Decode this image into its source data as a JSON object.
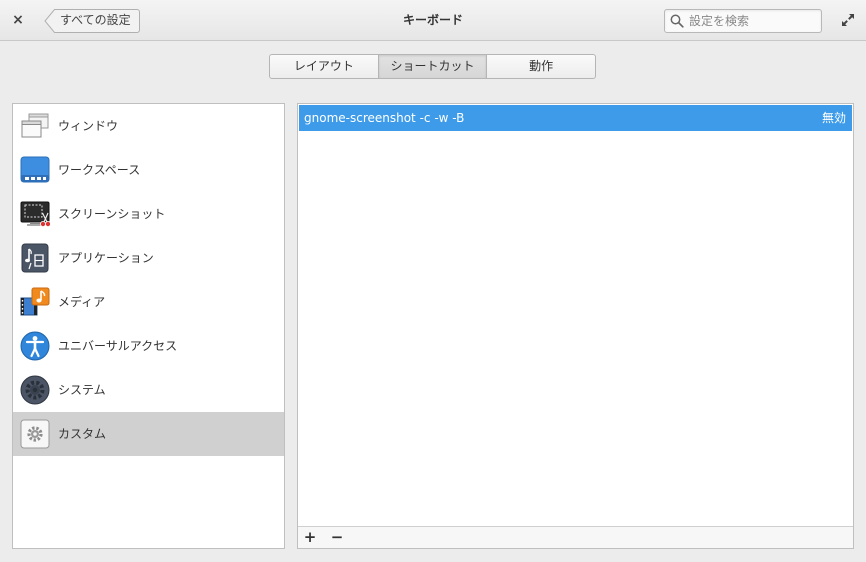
{
  "window": {
    "title": "キーボード",
    "back_label": "すべての設定",
    "search_placeholder": "設定を検索",
    "close_icon": "×"
  },
  "tabs": [
    {
      "label": "レイアウト",
      "active": false
    },
    {
      "label": "ショートカット",
      "active": true
    },
    {
      "label": "動作",
      "active": false
    }
  ],
  "sidebar": {
    "items": [
      {
        "label": "ウィンドウ",
        "icon": "window-icon"
      },
      {
        "label": "ワークスペース",
        "icon": "workspace-icon"
      },
      {
        "label": "スクリーンショット",
        "icon": "screenshot-icon"
      },
      {
        "label": "アプリケーション",
        "icon": "application-icon"
      },
      {
        "label": "メディア",
        "icon": "media-icon"
      },
      {
        "label": "ユニバーサルアクセス",
        "icon": "universal-access-icon"
      },
      {
        "label": "システム",
        "icon": "system-icon"
      },
      {
        "label": "カスタム",
        "icon": "custom-gear-icon",
        "selected": true
      }
    ]
  },
  "shortcuts": [
    {
      "command": "gnome-screenshot -c -w -B",
      "accel": "無効"
    }
  ],
  "toolbar": {
    "add_label": "+",
    "remove_label": "−"
  },
  "colors": {
    "selection": "#3d9bea",
    "sidebar_selected": "#d0d0d0"
  }
}
